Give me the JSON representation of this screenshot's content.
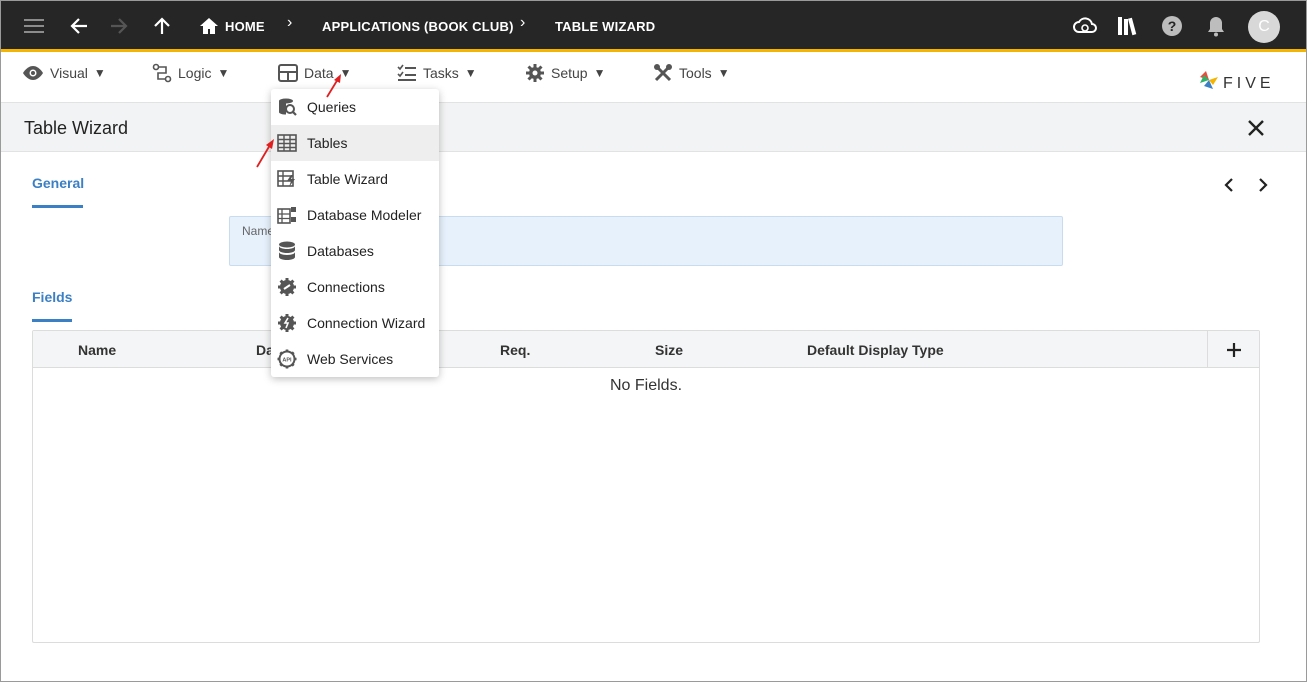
{
  "topbar": {
    "breadcrumbs": [
      "HOME",
      "APPLICATIONS (BOOK CLUB)",
      "TABLE WIZARD"
    ],
    "avatar_initial": "C",
    "icons": [
      "menu-icon",
      "back-arrow-icon",
      "forward-arrow-icon",
      "up-arrow-icon",
      "home-icon",
      "cloud-sync-icon",
      "library-icon",
      "help-icon",
      "bell-icon"
    ]
  },
  "menubar": {
    "items": [
      {
        "label": "Visual",
        "icon": "eye-icon"
      },
      {
        "label": "Logic",
        "icon": "logic-icon"
      },
      {
        "label": "Data",
        "icon": "table-icon"
      },
      {
        "label": "Tasks",
        "icon": "tasks-icon"
      },
      {
        "label": "Setup",
        "icon": "gear-icon"
      },
      {
        "label": "Tools",
        "icon": "tools-icon"
      }
    ],
    "logo_text": "FIVE"
  },
  "data_menu": {
    "items": [
      {
        "label": "Queries",
        "icon": "queries-icon"
      },
      {
        "label": "Tables",
        "icon": "tables-icon"
      },
      {
        "label": "Table Wizard",
        "icon": "table-wizard-icon"
      },
      {
        "label": "Database Modeler",
        "icon": "database-modeler-icon"
      },
      {
        "label": "Databases",
        "icon": "databases-icon"
      },
      {
        "label": "Connections",
        "icon": "connections-icon"
      },
      {
        "label": "Connection Wizard",
        "icon": "connection-wizard-icon"
      },
      {
        "label": "Web Services",
        "icon": "web-services-icon"
      }
    ],
    "hovered": "Tables"
  },
  "panel": {
    "title": "Table Wizard",
    "general_tab": "General",
    "name_label": "Name",
    "name_value": "",
    "fields_tab": "Fields"
  },
  "fields_table": {
    "columns": [
      "Name",
      "Da",
      "Req.",
      "Size",
      "Default Display Type"
    ],
    "empty_message": "No Fields."
  },
  "colors": {
    "topbar_bg": "#262626",
    "accent_border": "#f4b400",
    "link_blue": "#3b7fc4",
    "annotation_red": "#e02020"
  }
}
